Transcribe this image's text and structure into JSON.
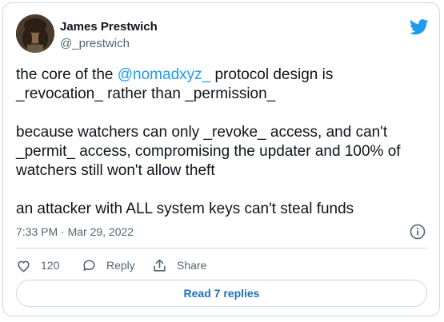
{
  "author": {
    "name": "James Prestwich",
    "handle": "@_prestwich"
  },
  "tweet": {
    "line1_before": "the core of the ",
    "mention": "@nomadxyz_",
    "line1_after": " protocol design is\n_revocation_ rather than _permission_",
    "para2": "because watchers can only _revoke_ access, and can't\n_permit_ access, compromising the updater and 100% of\nwatchers still won't allow theft",
    "para3": "an attacker with ALL system keys can't steal funds"
  },
  "meta": {
    "timestamp": "7:33 PM · Mar 29, 2022"
  },
  "actions": {
    "like_count": "120",
    "reply_label": "Reply",
    "share_label": "Share"
  },
  "read_replies_label": "Read 7 replies",
  "colors": {
    "brand_blue": "#1d9bf0",
    "link_blue": "#1d72b8",
    "secondary_text": "#536471",
    "border": "#cfd9de"
  },
  "icons": [
    "twitter-bird-icon",
    "info-icon",
    "heart-icon",
    "reply-icon",
    "share-icon"
  ]
}
